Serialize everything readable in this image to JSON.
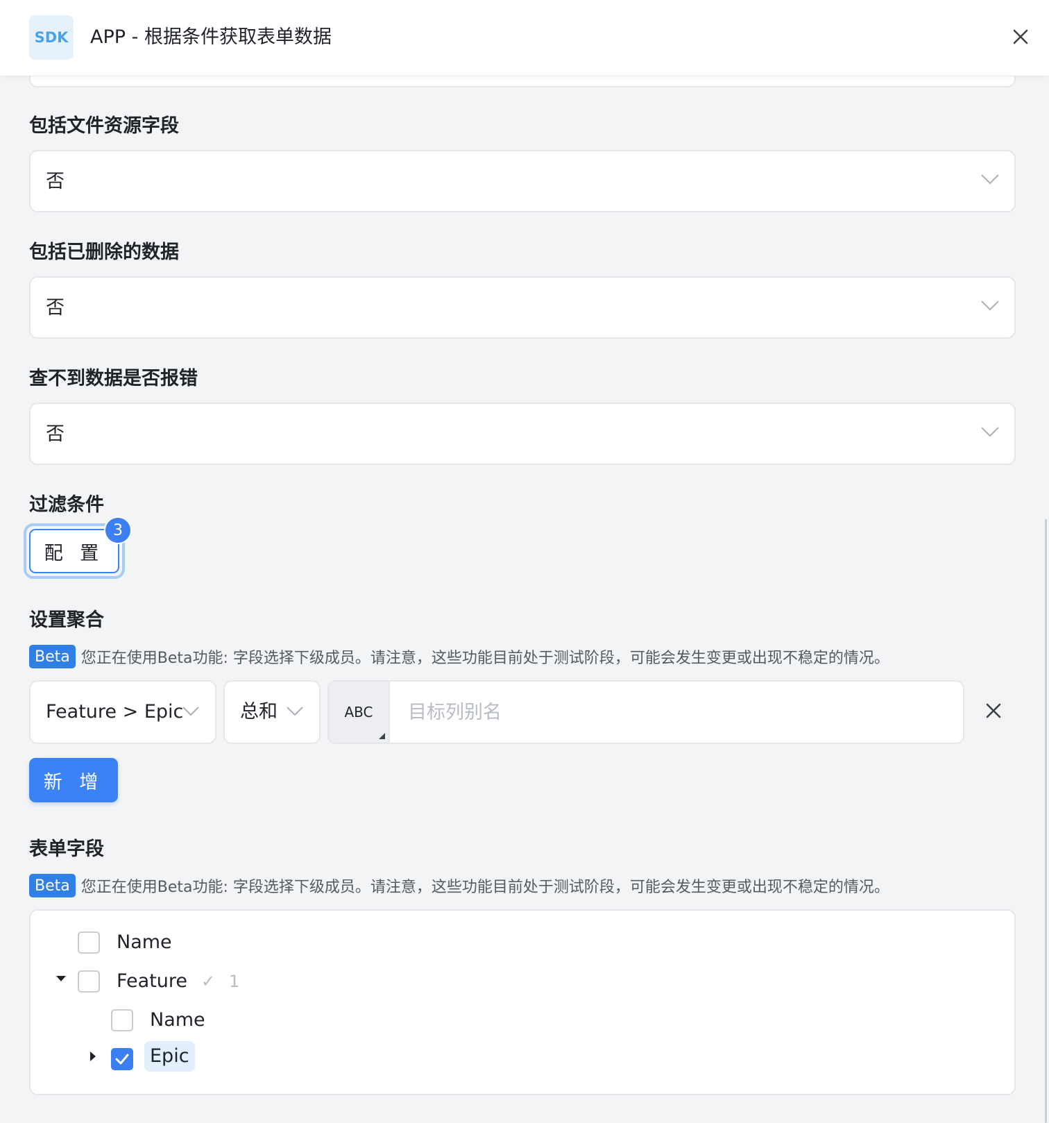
{
  "header": {
    "logo_text": "SDK",
    "title": "APP - 根据条件获取表单数据"
  },
  "fields": {
    "include_file_fields": {
      "label": "包括文件资源字段",
      "value": "否"
    },
    "include_deleted": {
      "label": "包括已删除的数据",
      "value": "否"
    },
    "error_if_not_found": {
      "label": "查不到数据是否报错",
      "value": "否"
    }
  },
  "filter": {
    "label": "过滤条件",
    "config_button": "配 置",
    "badge_count": "3"
  },
  "aggregation": {
    "label": "设置聚合",
    "beta_tag": "Beta",
    "beta_notice": "您正在使用Beta功能: 字段选择下级成员。请注意，这些功能目前处于测试阶段，可能会发生变更或出现不稳定的情况。",
    "field_value": "Feature > Epic",
    "function_value": "总和",
    "type_label": "ABC",
    "alias_placeholder": "目标列别名",
    "add_button": "新 增"
  },
  "form_fields": {
    "label": "表单字段",
    "beta_tag": "Beta",
    "beta_notice": "您正在使用Beta功能: 字段选择下级成员。请注意，这些功能目前处于测试阶段，可能会发生变更或出现不稳定的情况。",
    "tree": [
      {
        "label": "Name",
        "checked": false
      },
      {
        "label": "Feature",
        "checked": false,
        "expanded": true,
        "selected_count": "1",
        "children": [
          {
            "label": "Name",
            "checked": false
          },
          {
            "label": "Epic",
            "checked": true,
            "expanded": false
          }
        ]
      }
    ]
  },
  "colors": {
    "primary": "#3b82f6",
    "badge": "#3b7ff0",
    "background": "#f3f4f6"
  }
}
